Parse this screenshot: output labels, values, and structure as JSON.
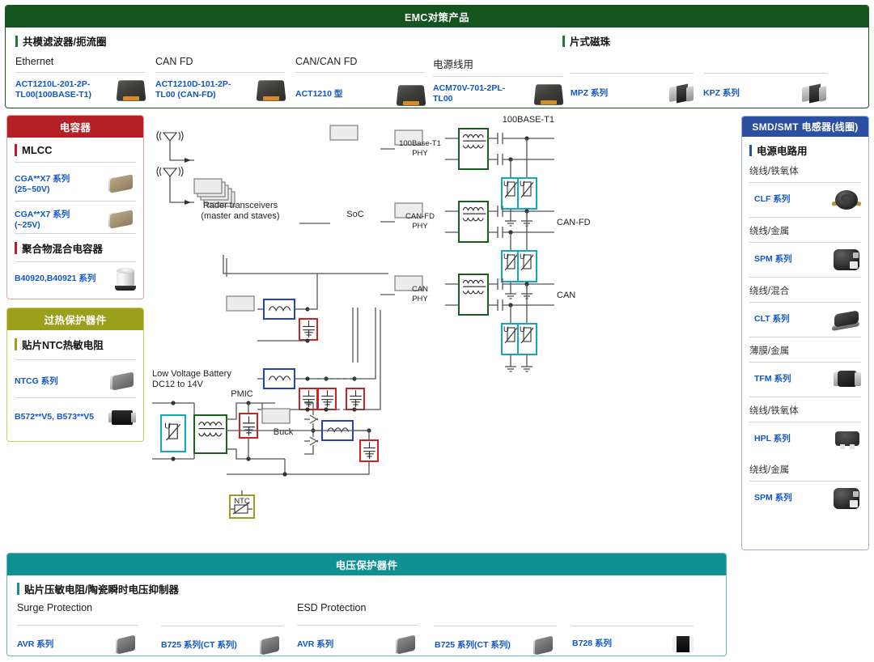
{
  "emc": {
    "title": "EMC对策产品",
    "header_color": "#14551f",
    "groups": [
      {
        "label": "共模滤波器/扼流圈",
        "tick_color": "#1e7a2e"
      },
      {
        "label": "片式磁珠",
        "tick_color": "#1e7a2e"
      }
    ],
    "columns": [
      {
        "head": "Ethernet",
        "pn": "ACT1210L-201-2P-TL00(100BASE-T1)",
        "icon": "cmc-icon"
      },
      {
        "head": "CAN FD",
        "pn": "ACT1210D-101-2P-TL00 (CAN-FD)",
        "icon": "cmc-icon"
      },
      {
        "head": "CAN/CAN FD",
        "pn": "ACT1210 型",
        "icon": "cmc-icon"
      },
      {
        "head": "电源线用",
        "pn": "ACM70V-701-2PL-TL00",
        "icon": "cmc-icon"
      },
      {
        "head": "",
        "pn": "MPZ 系列",
        "icon": "bead-icon"
      },
      {
        "head": "",
        "pn": "KPZ 系列",
        "icon": "bead-icon"
      }
    ]
  },
  "capacitor_panel": {
    "title": "电容器",
    "header_color": "#b42025",
    "border_color": "#e8a0a2",
    "sections": [
      {
        "label": "MLCC",
        "tick_color": "#b42025",
        "items": [
          {
            "pn": "CGA**X7 系列 (25~50V)",
            "icon": "mlcc-icon"
          },
          {
            "pn": "CGA**X7 系列 (~25V)",
            "icon": "mlcc-icon"
          }
        ]
      },
      {
        "label": "聚合物混合电容器",
        "tick_color": "#b42025",
        "items": [
          {
            "pn": "B40920,B40921 系列",
            "icon": "polymer-can-icon"
          }
        ]
      }
    ]
  },
  "thermal_panel": {
    "title": "过热保护器件",
    "header_color": "#9aa01b",
    "border_color": "#c9cf5e",
    "sections": [
      {
        "label": "贴片NTC热敏电阻",
        "tick_color": "#9aa01b",
        "items": [
          {
            "pn": "NTCG 系列",
            "icon": "ntc-chip-icon"
          },
          {
            "pn": "B572**V5, B573**V5",
            "icon": "black-smd-icon"
          }
        ]
      }
    ]
  },
  "inductor_panel": {
    "title": "SMD/SMT 电感器(线圈)",
    "header_color": "#2b4fa2",
    "border_color": "#9fb0d8",
    "group_label": "电源电路用",
    "group_tick_color": "#2b4fa2",
    "items": [
      {
        "sub": "绕线/铁氧体",
        "pn": "CLF 系列",
        "icon": "round-power-inductor-icon"
      },
      {
        "sub": "绕线/金属",
        "pn": "SPM 系列",
        "icon": "molded-power-inductor-icon"
      },
      {
        "sub": "绕线/混合",
        "pn": "CLT 系列",
        "icon": "flat-inductor-icon"
      },
      {
        "sub": "薄膜/金属",
        "pn": "TFM 系列",
        "icon": "thin-film-inductor-icon"
      },
      {
        "sub": "绕线/铁氧体",
        "pn": "HPL 系列",
        "icon": "hpl-inductor-icon"
      },
      {
        "sub": "绕线/金属",
        "pn": "SPM 系列",
        "icon": "molded-power-inductor-icon"
      }
    ]
  },
  "voltage_panel": {
    "title": "电压保护器件",
    "header_color": "#109090",
    "border_color": "#5fb9b9",
    "group_label": "贴片压敏电阻/陶瓷瞬时电压抑制器",
    "group_tick_color": "#109090",
    "columns": [
      {
        "head": "Surge Protection",
        "pn": "AVR 系列",
        "icon": "varistor-icon"
      },
      {
        "head": "",
        "pn": "B725 系列(CT 系列)",
        "icon": "varistor-icon"
      },
      {
        "head": "ESD Protection",
        "pn": "AVR 系列",
        "icon": "varistor-icon"
      },
      {
        "head": "",
        "pn": "B725 系列(CT 系列)",
        "icon": "varistor-icon"
      },
      {
        "head": "",
        "pn": "B728 系列",
        "icon": "b728-icon"
      }
    ]
  },
  "diagram": {
    "blocks": {
      "radar": "Rader transceivers\n(master and staves)",
      "radar_line1": "Rader transceivers",
      "radar_line2": "(master and staves)",
      "soc": "SoC",
      "pmic": "PMIC",
      "buck": "Buck",
      "phy1_line1": "100Base-T1",
      "phy1_line2": "PHY",
      "phy2_line1": "CAN-FD",
      "phy2_line2": "PHY",
      "phy3_line1": "CAN",
      "phy3_line2": "PHY",
      "ntc_label": "NTC"
    },
    "net_labels": {
      "eth": "100BASE-T1",
      "canfd": "CAN-FD",
      "can": "CAN"
    },
    "battery_line1": "Low Voltage Battery",
    "battery_line2": "DC12 to 14V",
    "colors": {
      "choke_green": "#1b5e20",
      "inductor_blue": "#2342c8",
      "capacitor_red": "#cc2222",
      "varistor_cyan": "#12a8bd",
      "ntc_olive": "#9aa01b",
      "wire": "#555555",
      "block_fill": "#ececec",
      "block_stroke": "#888888"
    }
  }
}
